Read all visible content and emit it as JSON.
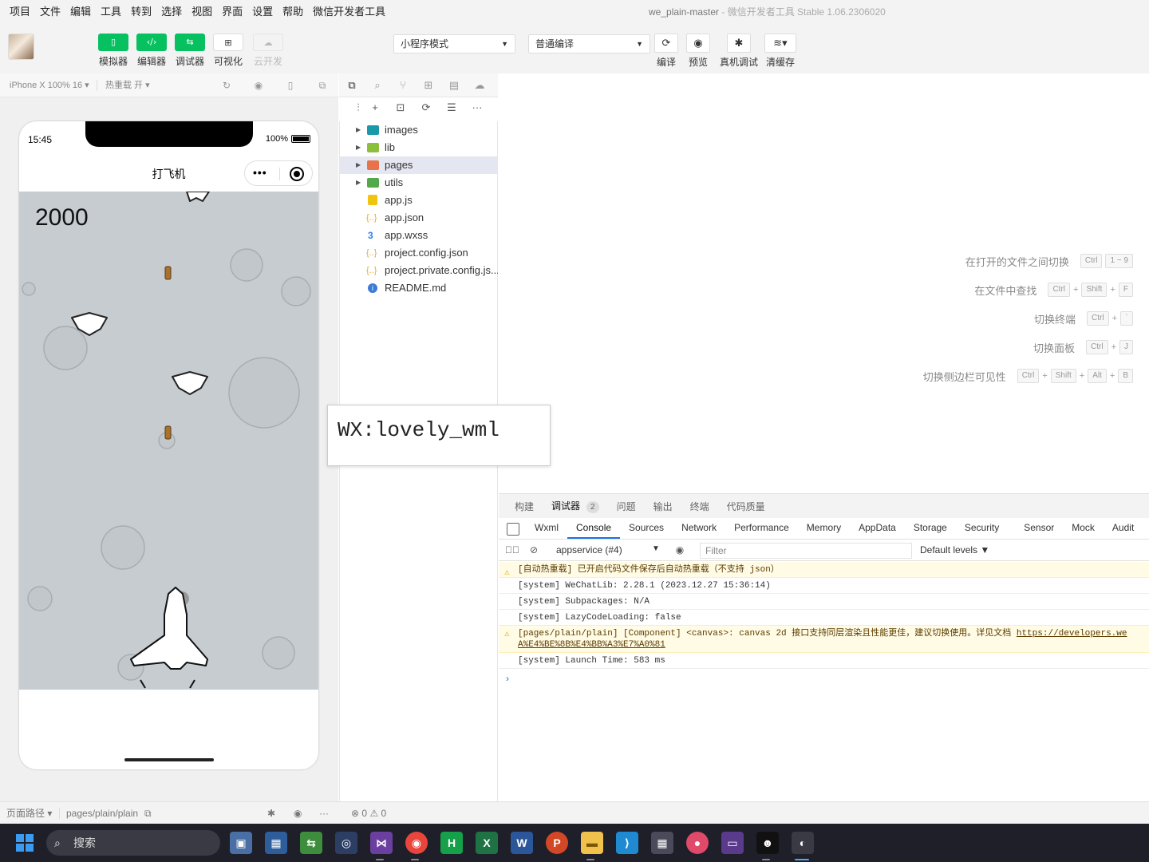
{
  "menu": [
    "项目",
    "文件",
    "编辑",
    "工具",
    "转到",
    "选择",
    "视图",
    "界面",
    "设置",
    "帮助",
    "微信开发者工具"
  ],
  "window_title": {
    "project": "we_plain-master",
    "sep": " - ",
    "app": "微信开发者工具 Stable 1.06.2306020"
  },
  "toolbar": {
    "buttons": [
      {
        "label": "模拟器",
        "icon": "phone-icon"
      },
      {
        "label": "编辑器",
        "icon": "code-icon"
      },
      {
        "label": "调试器",
        "icon": "debug-icon"
      },
      {
        "label": "可视化",
        "icon": "layout-icon"
      },
      {
        "label": "云开发",
        "icon": "cloud-icon"
      }
    ],
    "mode_select": "小程序模式",
    "compile_select": "普通编译",
    "actions": [
      {
        "label": "编译",
        "icon": "refresh-icon"
      },
      {
        "label": "预览",
        "icon": "eye-icon"
      },
      {
        "label": "真机调试",
        "icon": "bug-icon"
      },
      {
        "label": "清缓存",
        "icon": "layers-icon"
      }
    ]
  },
  "simulator": {
    "device": "iPhone X 100% 16 ▾",
    "hot_reload": "热重载 开 ▾",
    "status_time": "15:45",
    "battery": "100%",
    "nav_title": "打飞机",
    "capsule_dots": "•••",
    "score": "2000"
  },
  "explorer": {
    "files": [
      {
        "name": "images",
        "type": "folder-teal",
        "folder": true
      },
      {
        "name": "lib",
        "type": "folder-lime",
        "folder": true
      },
      {
        "name": "pages",
        "type": "folder-orange",
        "folder": true,
        "selected": true
      },
      {
        "name": "utils",
        "type": "folder-green",
        "folder": true
      },
      {
        "name": "app.js",
        "type": "js"
      },
      {
        "name": "app.json",
        "type": "json"
      },
      {
        "name": "app.wxss",
        "type": "css"
      },
      {
        "name": "project.config.json",
        "type": "json"
      },
      {
        "name": "project.private.config.js...",
        "type": "json"
      },
      {
        "name": "README.md",
        "type": "info"
      }
    ]
  },
  "shortcuts": [
    {
      "label": "在打开的文件之间切换",
      "keys": [
        "Ctrl",
        "1 ~ 9"
      ]
    },
    {
      "label": "在文件中查找",
      "keys": [
        "Ctrl",
        "Shift",
        "F"
      ]
    },
    {
      "label": "切换终端",
      "keys": [
        "Ctrl",
        "`"
      ]
    },
    {
      "label": "切换面板",
      "keys": [
        "Ctrl",
        "J"
      ]
    },
    {
      "label": "切换侧边栏可见性",
      "keys": [
        "Ctrl",
        "Shift",
        "Alt",
        "B"
      ]
    }
  ],
  "watermark": "WX:lovely_wml",
  "panel": {
    "tabs": [
      "构建",
      "调试器",
      "问题",
      "输出",
      "终端",
      "代码质量"
    ],
    "debugger_badge": "2",
    "devtools_tabs": [
      "Wxml",
      "Console",
      "Sources",
      "Network",
      "Performance",
      "Memory",
      "AppData",
      "Storage",
      "Security",
      "Sensor",
      "Mock",
      "Audit"
    ],
    "context": "appservice (#4)",
    "filter_placeholder": "Filter",
    "levels": "Default levels ▼",
    "logs": [
      {
        "level": "warn",
        "text": "[自动热重载] 已开启代码文件保存后自动热重载（不支持 json）"
      },
      {
        "level": "info",
        "text": "[system] WeChatLib: 2.28.1 (2023.12.27 15:36:14)"
      },
      {
        "level": "info",
        "text": "[system] Subpackages: N/A"
      },
      {
        "level": "info",
        "text": "[system] LazyCodeLoading: false"
      },
      {
        "level": "warn",
        "text": "[pages/plain/plain] [Component] <canvas>: canvas 2d 接口支持同层渲染且性能更佳，建议切换使用。详见文档 ",
        "link": "https://developers.we",
        "link2": "A%E4%BE%8B%E4%BB%A3%E7%A0%81"
      },
      {
        "level": "info",
        "text": "[system] Launch Time: 583 ms"
      }
    ]
  },
  "statusbar": {
    "page_path_label": "页面路径 ▾",
    "page_path": "pages/plain/plain",
    "errors": "0",
    "warnings": "0"
  },
  "taskbar": {
    "search": "搜索"
  }
}
